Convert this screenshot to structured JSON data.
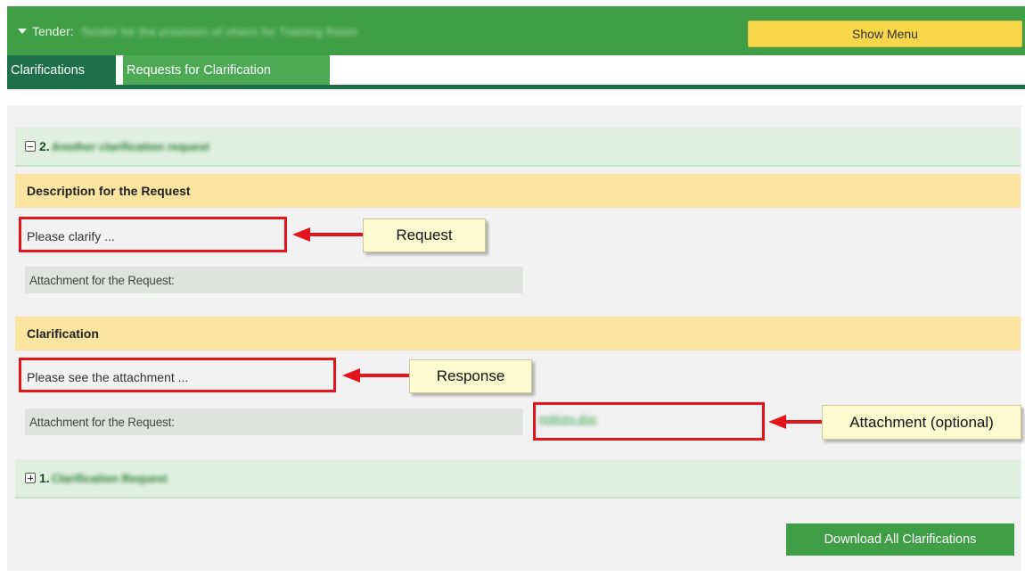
{
  "header": {
    "tender_label": "Tender:",
    "tender_name": "Tender for the provision of chairs for Training Room",
    "show_menu_label": "Show Menu"
  },
  "tabs": [
    {
      "label": "Clarifications",
      "active": true
    },
    {
      "label": "Requests for Clarification",
      "active": false
    }
  ],
  "requests": [
    {
      "number": "2.",
      "title": "Another clarification request",
      "expanded": true,
      "description_heading": "Description for the Request",
      "request_text": "Please clarify ...",
      "request_attachment_label": "Attachment for the Request:",
      "clarification_heading": "Clarification",
      "response_text": "Please see the attachment ...",
      "response_attachment_label": "Attachment for the Request:",
      "response_attachment_file": "notices.doc"
    },
    {
      "number": "1.",
      "title": "Clarification Request",
      "expanded": false
    }
  ],
  "annotations": {
    "request": "Request",
    "response": "Response",
    "attachment": "Attachment (optional)"
  },
  "footer": {
    "download_all_label": "Download All Clarifications"
  },
  "colors": {
    "header_green": "#3f9f47",
    "active_tab": "#1d7049",
    "inactive_tab": "#4caa55",
    "show_menu": "#f7d64a",
    "row_green": "#dff1de",
    "row_yellow": "#fbe3a0",
    "highlight_red": "#e4141b",
    "callout_bg": "#fdfad0"
  }
}
